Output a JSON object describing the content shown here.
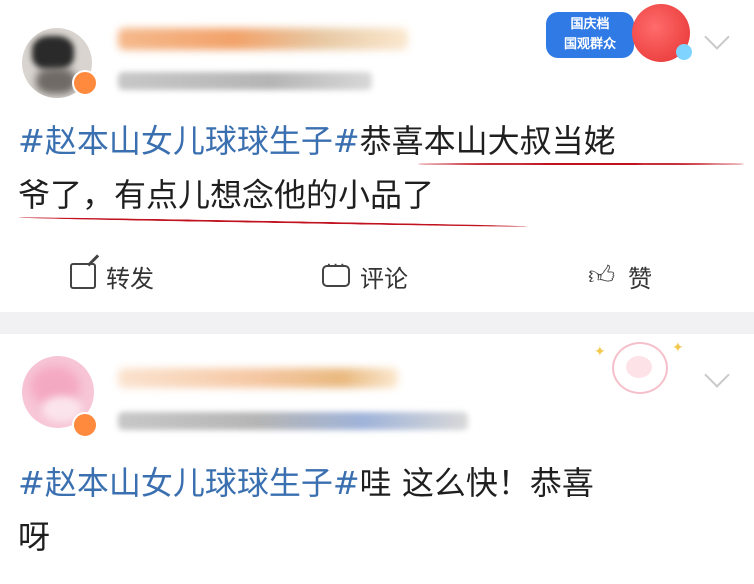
{
  "posts": [
    {
      "sticker_text": "国庆档\n国观群众",
      "content": {
        "hashtag": "#赵本山女儿球球生子#",
        "text_line1_rest": "恭喜本山大叔当姥",
        "text_line2": "爷了，有点儿想念他的小品了"
      },
      "actions": {
        "repost_label": "转发",
        "comment_label": "评论",
        "like_label": "赞"
      }
    },
    {
      "content": {
        "hashtag": "#赵本山女儿球球生子#",
        "text_line1_rest": "哇 这么快！恭喜",
        "text_line2": "呀"
      }
    }
  ],
  "icons": {
    "repost": "repost-icon",
    "comment": "comment-icon",
    "like": "thumbs-up-icon",
    "more": "chevron-down-icon"
  },
  "colors": {
    "hashtag": "#3a6fb0",
    "annotation_underline": "#c1121f",
    "separator": "#f1f1f3"
  }
}
